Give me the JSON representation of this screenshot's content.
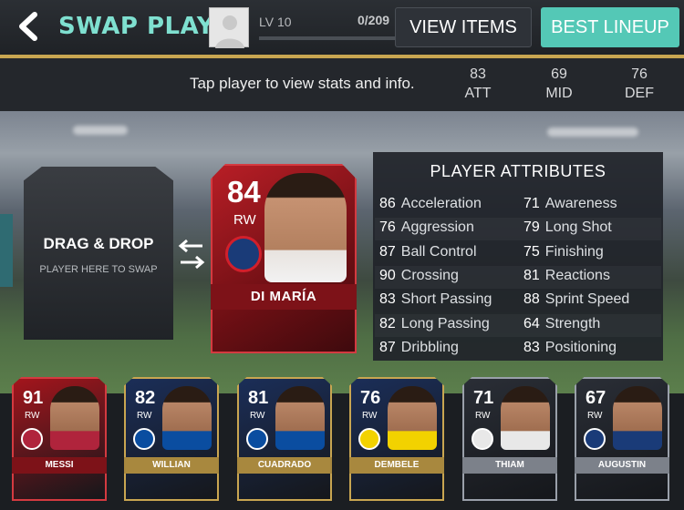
{
  "header": {
    "title": "SWAP PLAYER",
    "level": "LV 10",
    "xp_count": "0/209",
    "view_items_label": "VIEW ITEMS",
    "best_lineup_label": "BEST LINEUP"
  },
  "info": {
    "hint": "Tap player to view stats and info.",
    "stats": [
      {
        "value": "83",
        "label": "ATT"
      },
      {
        "value": "69",
        "label": "MID"
      },
      {
        "value": "76",
        "label": "DEF"
      }
    ]
  },
  "swap_slot": {
    "title": "DRAG & DROP",
    "subtitle": "PLAYER HERE TO SWAP"
  },
  "featured": {
    "ovr": "84",
    "pos": "RW",
    "name": "DI MARÍA",
    "card_color": "#b81e26"
  },
  "attributes": {
    "title": "PLAYER ATTRIBUTES",
    "left": [
      {
        "value": "86",
        "label": "Acceleration"
      },
      {
        "value": "76",
        "label": "Aggression"
      },
      {
        "value": "87",
        "label": "Ball Control"
      },
      {
        "value": "90",
        "label": "Crossing"
      },
      {
        "value": "83",
        "label": "Short Passing"
      },
      {
        "value": "82",
        "label": "Long Passing"
      },
      {
        "value": "87",
        "label": "Dribbling"
      }
    ],
    "right": [
      {
        "value": "71",
        "label": "Awareness"
      },
      {
        "value": "79",
        "label": "Long Shot"
      },
      {
        "value": "75",
        "label": "Finishing"
      },
      {
        "value": "81",
        "label": "Reactions"
      },
      {
        "value": "88",
        "label": "Sprint Speed"
      },
      {
        "value": "64",
        "label": "Strength"
      },
      {
        "value": "83",
        "label": "Positioning"
      }
    ]
  },
  "bench": [
    {
      "ovr": "91",
      "pos": "RW",
      "name": "MESSI",
      "color": "#a3151c",
      "badge": "#b0243c"
    },
    {
      "ovr": "82",
      "pos": "RW",
      "name": "WILLIAN",
      "color": "#1b2e58",
      "badge": "#0a4da0"
    },
    {
      "ovr": "81",
      "pos": "RW",
      "name": "CUADRADO",
      "color": "#1b2e58",
      "badge": "#0a4da0"
    },
    {
      "ovr": "76",
      "pos": "RW",
      "name": "DEMBELE",
      "color": "#1b2e58",
      "badge": "#f2d200"
    },
    {
      "ovr": "71",
      "pos": "RW",
      "name": "THIAM",
      "color": "#2a2e36",
      "badge": "#e8e8e8"
    },
    {
      "ovr": "67",
      "pos": "RW",
      "name": "AUGUSTIN",
      "color": "#2a2e36",
      "badge": "#1a3b78"
    }
  ]
}
